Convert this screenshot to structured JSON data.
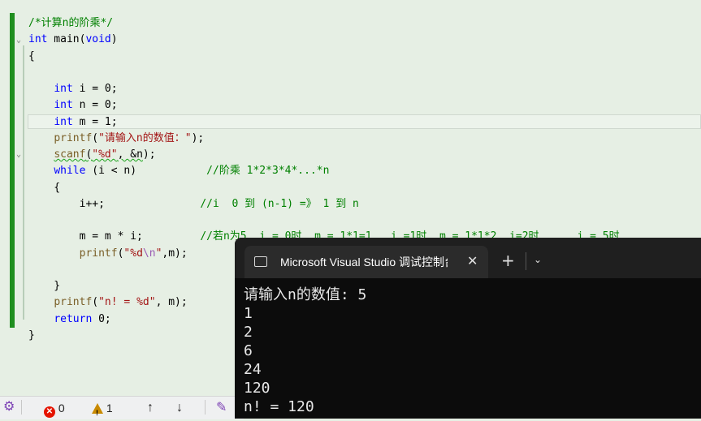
{
  "editor": {
    "lines": [
      {
        "parts": [
          {
            "t": "/*计算n的阶乘*/",
            "c": "cm"
          }
        ]
      },
      {
        "parts": [
          {
            "t": "int",
            "c": "kw"
          },
          {
            "t": " main("
          },
          {
            "t": "void",
            "c": "kw"
          },
          {
            "t": ")"
          }
        ]
      },
      {
        "parts": [
          {
            "t": "{"
          }
        ]
      },
      {
        "parts": [
          {
            "t": ""
          }
        ]
      },
      {
        "parts": [
          {
            "t": "    "
          },
          {
            "t": "int",
            "c": "kw"
          },
          {
            "t": " i = 0;"
          }
        ]
      },
      {
        "parts": [
          {
            "t": "    "
          },
          {
            "t": "int",
            "c": "kw"
          },
          {
            "t": " n = 0;"
          }
        ]
      },
      {
        "parts": [
          {
            "t": "    "
          },
          {
            "t": "int",
            "c": "kw"
          },
          {
            "t": " m = 1;"
          }
        ]
      },
      {
        "parts": [
          {
            "t": "    "
          },
          {
            "t": "printf",
            "c": "fn"
          },
          {
            "t": "("
          },
          {
            "t": "\"请输入n的数值：\"",
            "c": "str"
          },
          {
            "t": ");"
          }
        ]
      },
      {
        "parts": [
          {
            "t": "    "
          },
          {
            "t": "scanf",
            "c": "fn squig"
          },
          {
            "t": "(",
            "c": "squig"
          },
          {
            "t": "\"%d\"",
            "c": "str squig"
          },
          {
            "t": ", &n",
            "c": "squig"
          },
          {
            "t": ");"
          }
        ]
      },
      {
        "parts": [
          {
            "t": "    "
          },
          {
            "t": "while",
            "c": "kw"
          },
          {
            "t": " (i < n)           "
          },
          {
            "t": "//阶乘 1*2*3*4*...*n",
            "c": "cm"
          }
        ]
      },
      {
        "parts": [
          {
            "t": "    {"
          }
        ]
      },
      {
        "parts": [
          {
            "t": "        i++;               "
          },
          {
            "t": "//i  0 到 (n-1) =》 1 到 n",
            "c": "cm"
          }
        ]
      },
      {
        "parts": [
          {
            "t": ""
          }
        ]
      },
      {
        "parts": [
          {
            "t": "        m = m * i;         "
          },
          {
            "t": "//若n为5, i = 0时, m = 1*1=1,  i =1时, m = 1*1*2, i=2时, ....i = 5时...",
            "c": "cm"
          }
        ]
      },
      {
        "parts": [
          {
            "t": "        "
          },
          {
            "t": "printf",
            "c": "fn"
          },
          {
            "t": "("
          },
          {
            "t": "\"%d",
            "c": "str"
          },
          {
            "t": "\\n",
            "c": "esc"
          },
          {
            "t": "\"",
            "c": "str"
          },
          {
            "t": ",m);"
          }
        ]
      },
      {
        "parts": [
          {
            "t": ""
          }
        ]
      },
      {
        "parts": [
          {
            "t": "    }"
          }
        ]
      },
      {
        "parts": [
          {
            "t": "    "
          },
          {
            "t": "printf",
            "c": "fn"
          },
          {
            "t": "("
          },
          {
            "t": "\"n! = %d\"",
            "c": "str"
          },
          {
            "t": ", m);"
          }
        ]
      },
      {
        "parts": [
          {
            "t": "    "
          },
          {
            "t": "return",
            "c": "kw"
          },
          {
            "t": " 0;"
          }
        ]
      },
      {
        "parts": [
          {
            "t": "}"
          }
        ]
      }
    ]
  },
  "status_bar": {
    "errors": "0",
    "warnings": "1",
    "up_arrow": "↑",
    "down_arrow": "↓"
  },
  "console": {
    "tab_title": "Microsoft Visual Studio 调试控制台",
    "close_glyph": "✕",
    "new_tab_glyph": "+",
    "dropdown_glyph": "⌄",
    "output": [
      "请输入n的数值: 5",
      "1",
      "2",
      "6",
      "24",
      "120",
      "n! = 120"
    ]
  },
  "colors": {
    "editor_bg": "#e6efe4",
    "change_bar": "#1f8f1f",
    "console_bg": "#0c0c0c",
    "keyword": "#0000ff",
    "string": "#a31515",
    "comment": "#008000"
  }
}
